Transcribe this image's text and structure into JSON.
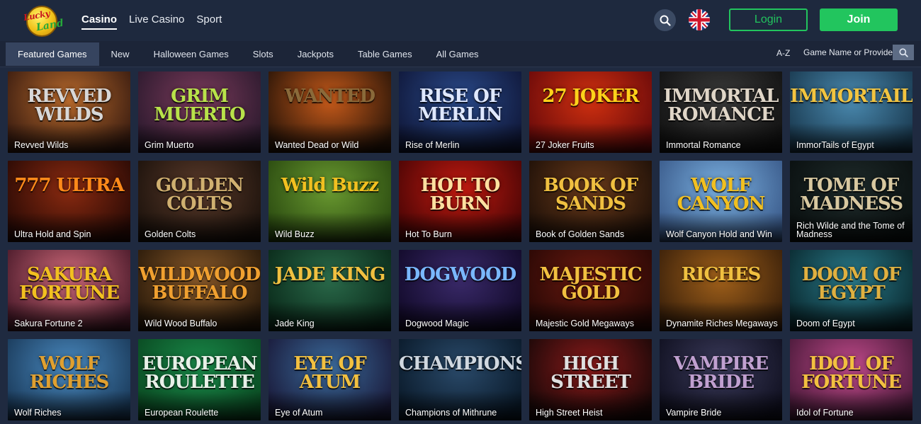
{
  "brand": {
    "logo_line1": "Lucky",
    "logo_line2": "Land"
  },
  "main_nav": [
    {
      "label": "Casino",
      "active": true
    },
    {
      "label": "Live Casino",
      "active": false
    },
    {
      "label": "Sport",
      "active": false
    }
  ],
  "header": {
    "login_label": "Login",
    "join_label": "Join"
  },
  "sub_nav": {
    "tabs": [
      {
        "label": "Featured Games",
        "active": true
      },
      {
        "label": "New",
        "active": false
      },
      {
        "label": "Halloween Games",
        "active": false
      },
      {
        "label": "Slots",
        "active": false
      },
      {
        "label": "Jackpots",
        "active": false
      },
      {
        "label": "Table Games",
        "active": false
      },
      {
        "label": "All Games",
        "active": false
      }
    ],
    "az_label": "A-Z",
    "search_placeholder": "Game Name or Provider"
  },
  "colors": {
    "accent_green": "#22c55e",
    "header_bg": "#1e293e",
    "page_bg": "#1f2a40"
  },
  "games": [
    {
      "name": "Revved Wilds",
      "art": "REVVED WILDS",
      "bg": [
        "#b86a2c",
        "#3a1c10"
      ],
      "fg": "#d8d8d8"
    },
    {
      "name": "Grim Muerto",
      "art": "GRIM MUERTO",
      "bg": [
        "#7a3a5a",
        "#2c1a2e"
      ],
      "fg": "#b8e24a"
    },
    {
      "name": "Wanted Dead or Wild",
      "art": "WANTED",
      "bg": [
        "#c65a1a",
        "#2a1508"
      ],
      "fg": "#8a6a3a"
    },
    {
      "name": "Rise of Merlin",
      "art": "RISE OF MERLIN",
      "bg": [
        "#2a4a8a",
        "#10183a"
      ],
      "fg": "#dfe8ff"
    },
    {
      "name": "27 Joker Fruits",
      "art": "27 JOKER",
      "bg": [
        "#d03010",
        "#6a0a0a"
      ],
      "fg": "#ffd21a"
    },
    {
      "name": "Immortal Romance",
      "art": "IMMORTAL ROMANCE",
      "bg": [
        "#3a3a3a",
        "#121212"
      ],
      "fg": "#e0d6c8"
    },
    {
      "name": "ImmorTails of Egypt",
      "art": "IMMORTAILS",
      "bg": [
        "#4a8ab0",
        "#1a3a50"
      ],
      "fg": "#f2c440"
    },
    {
      "name": "Ultra Hold and Spin",
      "art": "777 ULTRA",
      "bg": [
        "#8a2a10",
        "#2a0a05"
      ],
      "fg": "#ff8a1a"
    },
    {
      "name": "Golden Colts",
      "art": "GOLDEN COLTS",
      "bg": [
        "#5a3a2a",
        "#1c120c"
      ],
      "fg": "#d0b070"
    },
    {
      "name": "Wild Buzz",
      "art": "Wild Buzz",
      "bg": [
        "#6a9a30",
        "#2a4a10"
      ],
      "fg": "#f2c020"
    },
    {
      "name": "Hot To Burn",
      "art": "HOT TO BURN",
      "bg": [
        "#c01a10",
        "#4a0505"
      ],
      "fg": "#ffe0a0"
    },
    {
      "name": "Book of Golden Sands",
      "art": "BOOK OF SANDS",
      "bg": [
        "#6a3a1a",
        "#1e1008"
      ],
      "fg": "#f0c040"
    },
    {
      "name": "Wolf Canyon Hold and Win",
      "art": "WOLF CANYON",
      "bg": [
        "#7ab0e0",
        "#3a5a8a"
      ],
      "fg": "#f2c020"
    },
    {
      "name": "Rich Wilde and the Tome of Madness",
      "art": "TOME OF MADNESS",
      "bg": [
        "#1e2a2a",
        "#0a1010"
      ],
      "fg": "#d8c8a0"
    },
    {
      "name": "Sakura Fortune 2",
      "art": "SAKURA FORTUNE",
      "bg": [
        "#d06a7a",
        "#4a1a2a"
      ],
      "fg": "#f2c020"
    },
    {
      "name": "Wild Wood Buffalo",
      "art": "WILDWOOD BUFFALO",
      "bg": [
        "#8a5a2a",
        "#2a1a0a"
      ],
      "fg": "#f0a030"
    },
    {
      "name": "Jade King",
      "art": "JADE KING",
      "bg": [
        "#2a6a4a",
        "#0a2a1a"
      ],
      "fg": "#f0c040"
    },
    {
      "name": "Dogwood Magic",
      "art": "DOGWOOD",
      "bg": [
        "#3a2a6a",
        "#120a2a"
      ],
      "fg": "#7ab8ff"
    },
    {
      "name": "Majestic Gold Megaways",
      "art": "MAJESTIC GOLD",
      "bg": [
        "#6a1a10",
        "#2a0805"
      ],
      "fg": "#f2c040"
    },
    {
      "name": "Dynamite Riches Megaways",
      "art": "RICHES",
      "bg": [
        "#a0601a",
        "#3a200a"
      ],
      "fg": "#f0c040"
    },
    {
      "name": "Doom of Egypt",
      "art": "DOOM OF EGYPT",
      "bg": [
        "#2a7a8a",
        "#0a2a30"
      ],
      "fg": "#e0b040"
    },
    {
      "name": "Wolf Riches",
      "art": "WOLF RICHES",
      "bg": [
        "#4a8ac0",
        "#1a3a5a"
      ],
      "fg": "#e0a030"
    },
    {
      "name": "European Roulette",
      "art": "EUROPEAN ROULETTE",
      "bg": [
        "#1a8a4a",
        "#0a4a22"
      ],
      "fg": "#e8f0e8"
    },
    {
      "name": "Eye of Atum",
      "art": "EYE OF ATUM",
      "bg": [
        "#3a6a9a",
        "#1a1a3a"
      ],
      "fg": "#f2c040"
    },
    {
      "name": "Champions of Mithrune",
      "art": "CHAMPIONS",
      "bg": [
        "#2a4a6a",
        "#0a1a2a"
      ],
      "fg": "#d0d8e0"
    },
    {
      "name": "High Street Heist",
      "art": "HIGH STREET",
      "bg": [
        "#8a1a1a",
        "#1a0808"
      ],
      "fg": "#e0e0e0"
    },
    {
      "name": "Vampire Bride",
      "art": "VAMPIRE BRIDE",
      "bg": [
        "#3a3a5a",
        "#101020"
      ],
      "fg": "#c0a0d0"
    },
    {
      "name": "Idol of Fortune",
      "art": "IDOL OF FORTUNE",
      "bg": [
        "#c04a8a",
        "#4a1a3a"
      ],
      "fg": "#f2c040"
    }
  ]
}
